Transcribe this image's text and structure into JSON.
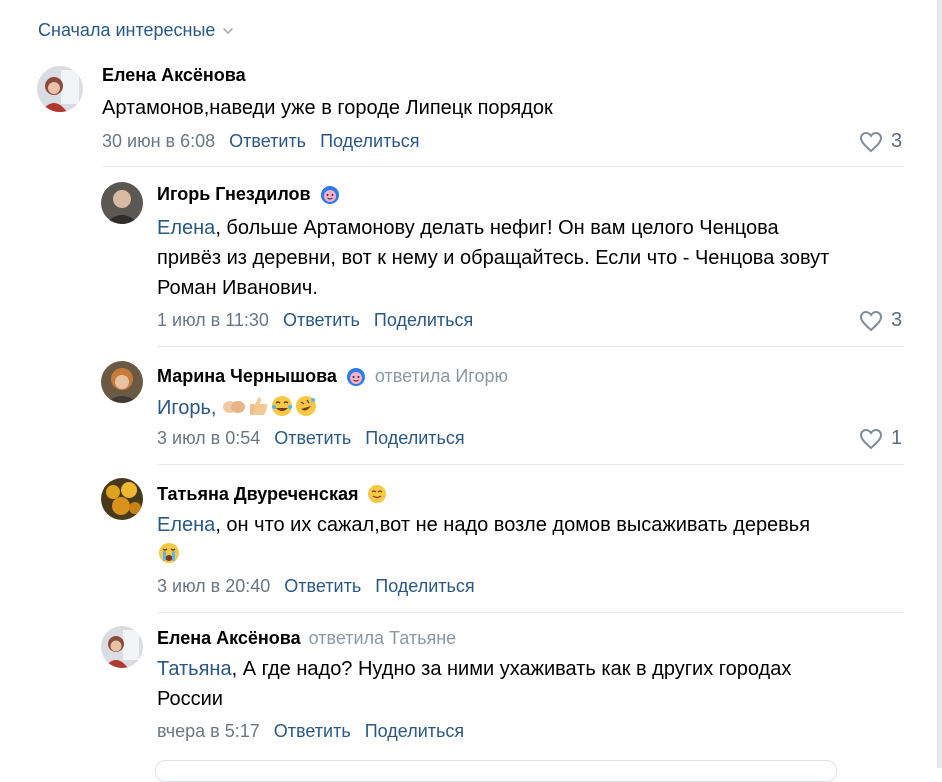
{
  "sort": {
    "label": "Сначала интересные"
  },
  "comments": [
    {
      "author": "Елена Аксёнова",
      "text": "Артамонов,наведи уже в городе Липецк порядок",
      "date": "30 июн в 6:08",
      "reply": "Ответить",
      "share": "Поделиться",
      "likes": "3"
    },
    {
      "author": "Игорь Гнездилов",
      "mention": "Елена",
      "text_line1": ", больше Артамонову делать нефиг! Он вам целого Ченцова",
      "text_line2": "привёз из деревни, вот к нему и обращайтесь. Если что - Ченцова зовут",
      "text_line3": "Роман Иванович.",
      "date": "1 июл в 11:30",
      "reply": "Ответить",
      "share": "Поделиться",
      "likes": "3"
    },
    {
      "author": "Марина Чернышова",
      "replied_to": "ответила Игорю",
      "text": "Игорь, ",
      "date": "3 июл в 0:54",
      "reply": "Ответить",
      "share": "Поделиться",
      "likes": "1"
    },
    {
      "author": "Татьяна Двуреченская",
      "mention": "Елена",
      "text": ", он что их сажал,вот не надо возле домов высаживать деревья",
      "date": "3 июл в 20:40",
      "reply": "Ответить",
      "share": "Поделиться"
    },
    {
      "author": "Елена Аксёнова",
      "replied_to": "ответила Татьяне",
      "mention": "Татьяна",
      "text_line1": ", А где надо? Нудно за ними ухаживать как в других городах",
      "text_line2": "России",
      "date": "вчера в 5:17",
      "reply": "Ответить",
      "share": "Поделиться"
    }
  ],
  "colors": {
    "link": "#2a5885",
    "muted": "#6b7785",
    "divider": "#e7e8ec"
  }
}
